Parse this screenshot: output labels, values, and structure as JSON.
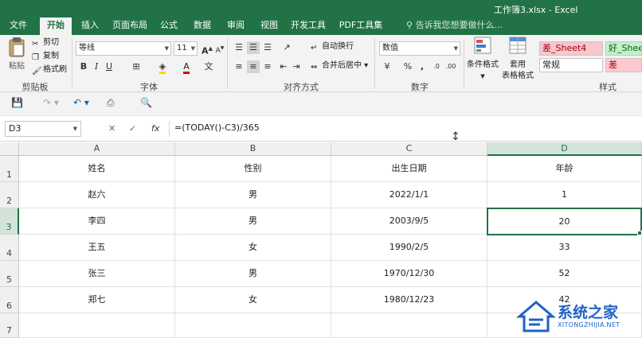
{
  "window": {
    "title": "工作簿3.xlsx - Excel"
  },
  "tabs": [
    {
      "label": "文件"
    },
    {
      "label": "开始"
    },
    {
      "label": "插入"
    },
    {
      "label": "页面布局"
    },
    {
      "label": "公式"
    },
    {
      "label": "数据"
    },
    {
      "label": "审阅"
    },
    {
      "label": "视图"
    },
    {
      "label": "开发工具"
    },
    {
      "label": "PDF工具集"
    }
  ],
  "tell_me": "告诉我您想要做什么...",
  "ribbon": {
    "clipboard": {
      "paste": "粘贴",
      "cut": "剪切",
      "copy": "复制",
      "format_painter": "格式刷",
      "label": "剪贴板"
    },
    "font": {
      "name": "等线",
      "size": "11",
      "label": "字体",
      "bold": "B",
      "italic": "I",
      "underline": "U",
      "grow": "A",
      "shrink": "A"
    },
    "alignment": {
      "wrap": "自动换行",
      "merge": "合并后居中",
      "label": "对齐方式"
    },
    "number": {
      "format": "数值",
      "percent": "%",
      "comma": ",",
      "label": "数字"
    },
    "styles": {
      "conditional": "条件格式",
      "table_line1": "套用",
      "table_line2": "表格格式",
      "cells": [
        {
          "text": "差_Sheet4",
          "bg": "#f7c6ce",
          "color": "#9c0006"
        },
        {
          "text": "好_Sheet",
          "bg": "#c6efce",
          "color": "#006100"
        },
        {
          "text": "常规",
          "bg": "#ffffff",
          "color": "#222222"
        },
        {
          "text": "差",
          "bg": "#ffc7ce",
          "color": "#9c0006"
        }
      ],
      "label": "样式"
    }
  },
  "formula_bar": {
    "name_box": "D3",
    "cancel": "✕",
    "enter": "✓",
    "fx": "fx",
    "formula": "=(TODAY()-C3)/365"
  },
  "columns": [
    "A",
    "B",
    "C",
    "D"
  ],
  "rows": [
    "1",
    "2",
    "3",
    "4",
    "5",
    "6",
    "7"
  ],
  "table": [
    [
      "姓名",
      "性别",
      "出生日期",
      "年龄"
    ],
    [
      "赵六",
      "男",
      "2022/1/1",
      "1"
    ],
    [
      "李四",
      "男",
      "2003/9/5",
      "20"
    ],
    [
      "王五",
      "女",
      "1990/2/5",
      "33"
    ],
    [
      "张三",
      "男",
      "1970/12/30",
      "52"
    ],
    [
      "郑七",
      "女",
      "1980/12/23",
      "42"
    ]
  ],
  "watermark": {
    "text": "系统之家",
    "sub": "XITONGZHIJIA.NET"
  },
  "colors": {
    "accent": "#217346"
  }
}
